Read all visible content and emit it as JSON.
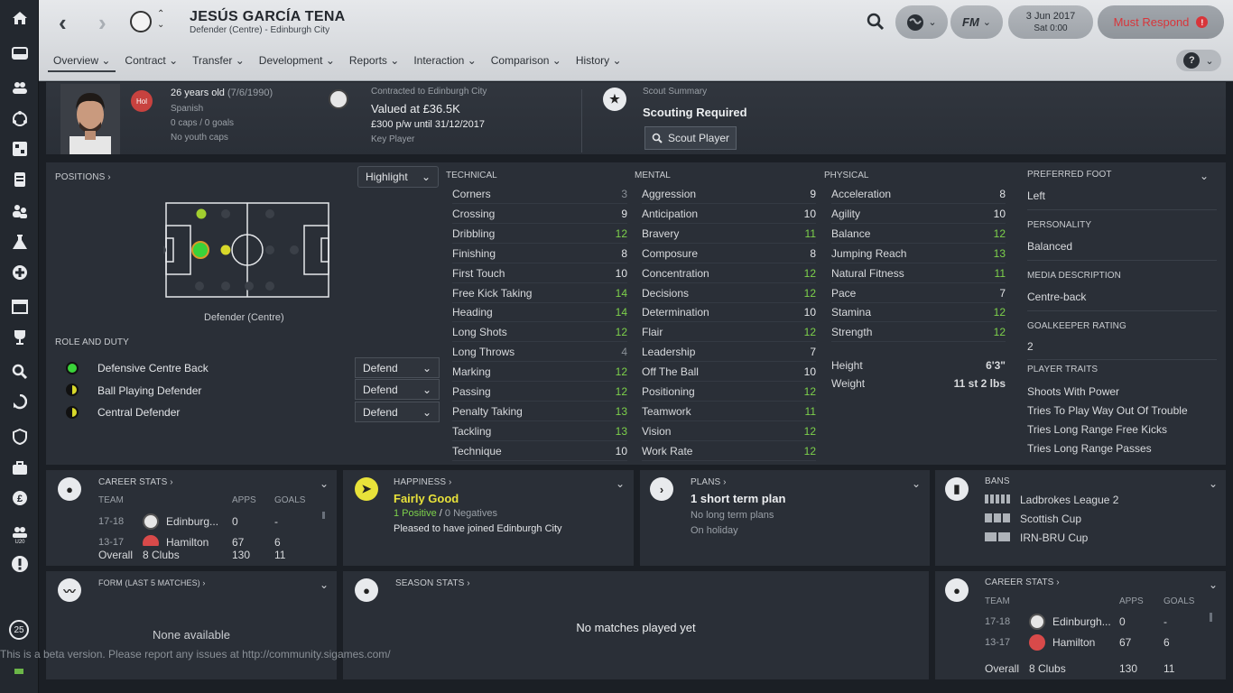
{
  "sidebar": {
    "icons": [
      "home-icon",
      "inbox-icon",
      "squad-icon",
      "tactics-icon",
      "data-icon",
      "dynamics-icon",
      "staff-icon",
      "training-icon",
      "medical-icon",
      "schedule-icon",
      "competitions-icon",
      "scouting-icon",
      "transfers-icon",
      "club-vision-icon",
      "club-info-icon",
      "finances-icon",
      "u20-icon",
      "alert-icon"
    ],
    "bottom_badge": "25"
  },
  "topbar": {
    "player_name": "JESÚS GARCÍA TENA",
    "player_sub": "Defender (Centre) - Edinburgh City",
    "date": "3 Jun 2017",
    "time": "Sat 0:00",
    "must_respond": "Must Respond",
    "must_badge": "!",
    "fm_label": "FM"
  },
  "tabs": [
    {
      "label": "Overview"
    },
    {
      "label": "Contract"
    },
    {
      "label": "Transfer"
    },
    {
      "label": "Development"
    },
    {
      "label": "Reports"
    },
    {
      "label": "Interaction"
    },
    {
      "label": "Comparison"
    },
    {
      "label": "History"
    }
  ],
  "profile": {
    "age": "26 years old",
    "dob": "(7/6/1990)",
    "nationality": "Spanish",
    "nation_badge": "Hol",
    "caps": "0 caps / 0 goals",
    "youth": "No youth caps"
  },
  "contract": {
    "label": "Contracted to Edinburgh City",
    "value": "Valued at £36.5K",
    "wage": "£300 p/w until 31/12/2017",
    "status": "Key Player"
  },
  "scout": {
    "label": "Scout Summary",
    "value": "Scouting Required",
    "button": "Scout Player"
  },
  "positions": {
    "title": "POSITIONS",
    "highlight": "Highlight",
    "position_label": "Defender (Centre)"
  },
  "roles": {
    "title": "ROLE AND DUTY",
    "items": [
      {
        "name": "Defensive Centre Back",
        "duty": "Defend",
        "color": "#3ad33a"
      },
      {
        "name": "Ball Playing Defender",
        "duty": "Defend",
        "color": "#d8d82a"
      },
      {
        "name": "Central Defender",
        "duty": "Defend",
        "color": "#d8d82a"
      }
    ]
  },
  "technical": {
    "title": "TECHNICAL",
    "rows": [
      [
        "Corners",
        "3"
      ],
      [
        "Crossing",
        "9"
      ],
      [
        "Dribbling",
        "12"
      ],
      [
        "Finishing",
        "8"
      ],
      [
        "First Touch",
        "10"
      ],
      [
        "Free Kick Taking",
        "14"
      ],
      [
        "Heading",
        "14"
      ],
      [
        "Long Shots",
        "12"
      ],
      [
        "Long Throws",
        "4"
      ],
      [
        "Marking",
        "12"
      ],
      [
        "Passing",
        "12"
      ],
      [
        "Penalty Taking",
        "13"
      ],
      [
        "Tackling",
        "13"
      ],
      [
        "Technique",
        "10"
      ]
    ]
  },
  "mental": {
    "title": "MENTAL",
    "rows": [
      [
        "Aggression",
        "9"
      ],
      [
        "Anticipation",
        "10"
      ],
      [
        "Bravery",
        "11"
      ],
      [
        "Composure",
        "8"
      ],
      [
        "Concentration",
        "12"
      ],
      [
        "Decisions",
        "12"
      ],
      [
        "Determination",
        "10"
      ],
      [
        "Flair",
        "12"
      ],
      [
        "Leadership",
        "7"
      ],
      [
        "Off The Ball",
        "10"
      ],
      [
        "Positioning",
        "12"
      ],
      [
        "Teamwork",
        "11"
      ],
      [
        "Vision",
        "12"
      ],
      [
        "Work Rate",
        "12"
      ]
    ]
  },
  "physical": {
    "title": "PHYSICAL",
    "rows": [
      [
        "Acceleration",
        "8"
      ],
      [
        "Agility",
        "10"
      ],
      [
        "Balance",
        "12"
      ],
      [
        "Jumping Reach",
        "13"
      ],
      [
        "Natural Fitness",
        "11"
      ],
      [
        "Pace",
        "7"
      ],
      [
        "Stamina",
        "12"
      ],
      [
        "Strength",
        "12"
      ]
    ],
    "height_label": "Height",
    "height": "6'3\"",
    "weight_label": "Weight",
    "weight": "11 st 2 lbs"
  },
  "info": {
    "foot_label": "PREFERRED FOOT",
    "foot": "Left",
    "personality_label": "PERSONALITY",
    "personality": "Balanced",
    "media_label": "MEDIA DESCRIPTION",
    "media": "Centre-back",
    "gk_label": "GOALKEEPER RATING",
    "gk": "2",
    "traits_label": "PLAYER TRAITS",
    "traits": [
      "Shoots With Power",
      "Tries To Play Way Out Of Trouble",
      "Tries Long Range Free Kicks",
      "Tries Long Range Passes"
    ]
  },
  "career": {
    "title": "CAREER STATS",
    "col_team": "TEAM",
    "col_apps": "APPS",
    "col_goals": "GOALS",
    "rows": [
      {
        "season": "17-18",
        "team": "Edinburg...",
        "apps": "0",
        "goals": "-"
      },
      {
        "season": "13-17",
        "team": "Hamilton",
        "apps": "67",
        "goals": "6"
      }
    ],
    "overall_label": "Overall",
    "overall_clubs": "8 Clubs",
    "overall_apps": "130",
    "overall_goals": "11"
  },
  "career2": {
    "team1": "Edinburgh...",
    "team2": "Hamilton"
  },
  "happiness": {
    "title": "HAPPINESS",
    "value": "Fairly Good",
    "positives": "1 Positive",
    "sep": "/",
    "negatives": "0 Negatives",
    "note": "Pleased to have joined Edinburgh City"
  },
  "plans": {
    "title": "PLANS",
    "value": "1 short term plan",
    "line2": "No long term plans",
    "line3": "On holiday"
  },
  "bans": {
    "title": "BANS",
    "items": [
      "Ladbrokes League 2",
      "Scottish Cup",
      "IRN-BRU Cup"
    ]
  },
  "form": {
    "title": "FORM (LAST 5 MATCHES)",
    "empty": "None available"
  },
  "season": {
    "title": "SEASON STATS",
    "empty": "No matches played yet"
  },
  "beta": "This is a beta version. Please report any issues at http://community.sigames.com/"
}
